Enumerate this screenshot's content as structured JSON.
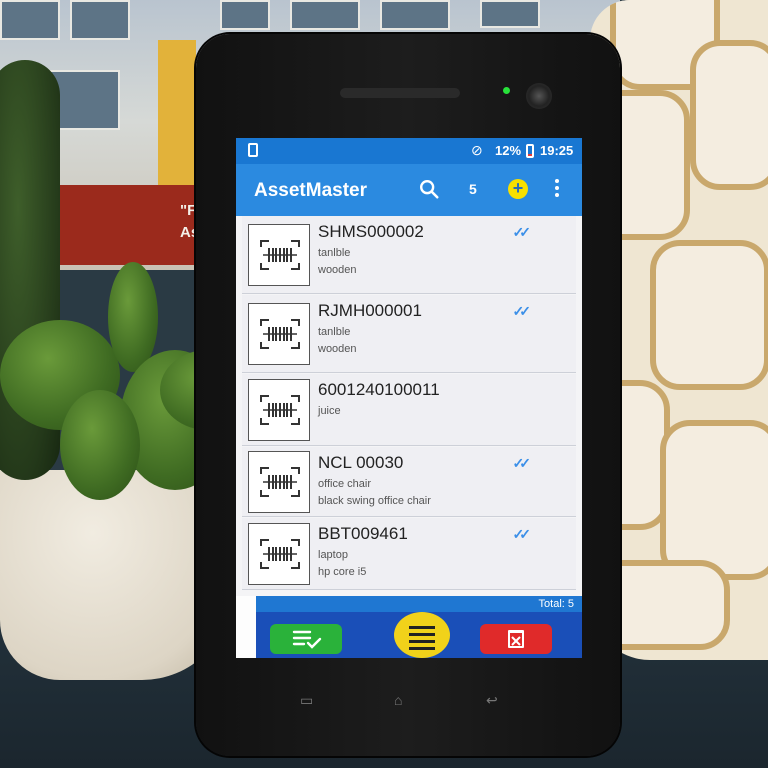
{
  "status_bar": {
    "battery_percent": "12%",
    "time": "19:25"
  },
  "app_bar": {
    "title": "AssetMaster",
    "count": "5",
    "icons": [
      "search-icon",
      "add-icon",
      "more-vert-icon"
    ]
  },
  "assets": [
    {
      "code": "SHMS000002",
      "line1": "tanlble",
      "line2": "wooden",
      "verified": true
    },
    {
      "code": "RJMH000001",
      "line1": "tanlble",
      "line2": "wooden",
      "verified": true
    },
    {
      "code": "6001240100011",
      "line1": "juice",
      "line2": "",
      "verified": false
    },
    {
      "code": "NCL 00030",
      "line1": "office chair",
      "line2": "black swing office chair",
      "verified": true
    },
    {
      "code": "BBT009461",
      "line1": "laptop",
      "line2": "hp core i5",
      "verified": true
    }
  ],
  "footer": {
    "total_label": "Total: 5"
  },
  "background": {
    "poster_text": "\"F\nAs"
  },
  "colors": {
    "statusbar": "#1977d2",
    "appbar": "#2b8ae0",
    "accent_yellow": "#f1d21a",
    "confirm_green": "#2ab23a",
    "delete_red": "#e02a2a",
    "check_blue": "#3b8fe8"
  }
}
